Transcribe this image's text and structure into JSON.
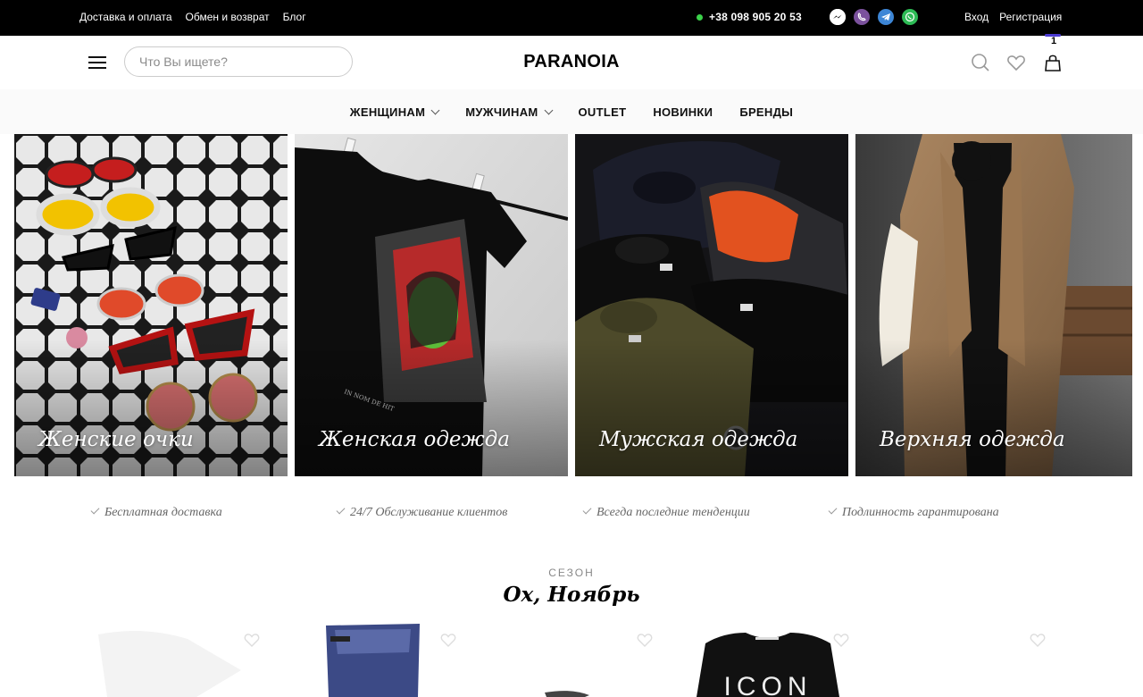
{
  "topbar": {
    "links": [
      "Доставка и оплата",
      "Обмен и возврат",
      "Блог"
    ],
    "phone": "+38 098 905 20 53",
    "socials": [
      {
        "icon": "messenger-icon",
        "color": "#ffffff"
      },
      {
        "icon": "viber-icon",
        "color": "#7b519d"
      },
      {
        "icon": "telegram-icon",
        "color": "#3d86d6"
      },
      {
        "icon": "whatsapp-icon",
        "color": "#2dbb55"
      }
    ],
    "login": "Вход",
    "register": "Регистрация"
  },
  "header": {
    "search_placeholder": "Что Вы ищете?",
    "logo": "PARANOIA",
    "cart_count": "1"
  },
  "nav": {
    "items": [
      {
        "label": "ЖЕНЩИНАМ",
        "dropdown": true
      },
      {
        "label": "МУЖЧИНАМ",
        "dropdown": true
      },
      {
        "label": "OUTLET",
        "dropdown": false
      },
      {
        "label": "НОВИНКИ",
        "dropdown": false
      },
      {
        "label": "БРЕНДЫ",
        "dropdown": false
      }
    ]
  },
  "categories": [
    {
      "label": "Женские очки"
    },
    {
      "label": "Женская одежда"
    },
    {
      "label": "Мужская одежда"
    },
    {
      "label": "Верхняя одежда"
    }
  ],
  "benefits": [
    "Бесплатная доставка",
    "24/7 Обслуживание клиентов",
    "Всегда последние тенденции",
    "Подлинность гарантирована"
  ],
  "season": {
    "kicker": "СЕЗОН",
    "title": "Ох, Ноябрь"
  },
  "colors": {
    "accent": "#4a3ad1",
    "online_dot": "#3bd24a"
  }
}
